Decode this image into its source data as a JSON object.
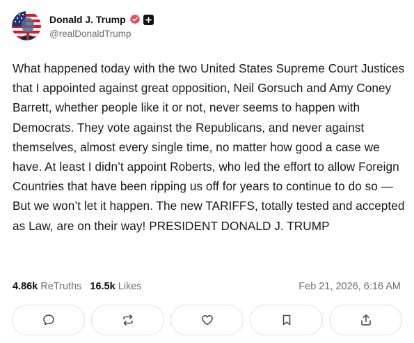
{
  "post": {
    "author": {
      "display_name": "Donald J. Trump",
      "handle": "@realDonaldTrump",
      "verified_icon": "verified-badge-icon",
      "badge_icon": "plus-badge-icon"
    },
    "text": "What happened today with the two United States Supreme Court Justices that I appointed against great opposition, Neil Gorsuch and Amy Coney Barrett, whether people like it or not, never seems to happen with Democrats. They vote against the Republicans, and never against themselves, almost every single time, no matter how good a case we have. At least I didn’t appoint Roberts, who led the effort to allow Foreign Countries that have been ripping us off for years to continue to do so — But we won’t let it happen. The new TARIFFS, totally tested and accepted as Law, are on their way! PRESIDENT DONALD J. TRUMP",
    "stats": {
      "retruths_count": "4.86k",
      "retruths_label": "ReTruths",
      "likes_count": "16.5k",
      "likes_label": "Likes"
    },
    "timestamp": "Feb 21, 2026, 6:16 AM"
  },
  "actions": [
    {
      "name": "reply-button",
      "icon": "comment-icon"
    },
    {
      "name": "retruth-button",
      "icon": "repost-icon"
    },
    {
      "name": "like-button",
      "icon": "heart-icon"
    },
    {
      "name": "bookmark-button",
      "icon": "bookmark-icon"
    },
    {
      "name": "share-button",
      "icon": "share-icon"
    }
  ],
  "colors": {
    "text": "#18181b",
    "muted": "#6b6e76",
    "verified": "#e8495f",
    "border": "#dcdde1"
  }
}
